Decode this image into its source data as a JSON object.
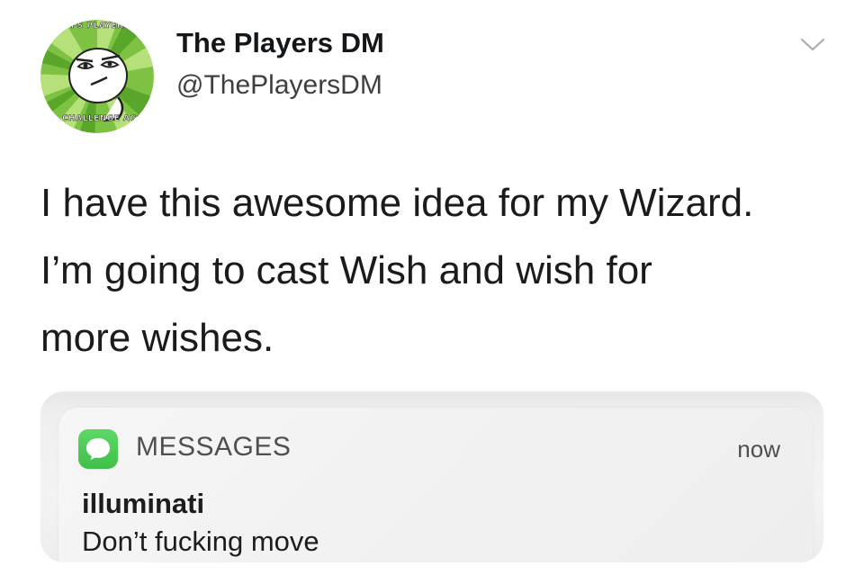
{
  "tweet": {
    "author": {
      "name": "The Players DM",
      "handle": "@ThePlayersDM",
      "avatar_icon": "challenge-accepted-meme-avatar",
      "avatar_caption_top": "THE THAT APPS PLAYERS AND DM'S?",
      "avatar_caption_bottom": "CHALLENGE ACCEPTED"
    },
    "menu_icon": "chevron-down-icon",
    "text_lines": [
      "I have this awesome idea for my Wizard.",
      "I’m going to cast Wish and wish for",
      "more wishes."
    ]
  },
  "notification": {
    "app_icon": "messages-icon",
    "app_name": "MESSAGES",
    "time": "now",
    "sender": "illuminati",
    "message": "Don’t fucking move"
  },
  "colors": {
    "messages_green": "#4cc956",
    "avatar_green": "#7dc242",
    "text": "#14171a",
    "secondary_text": "#4f4f4f"
  }
}
